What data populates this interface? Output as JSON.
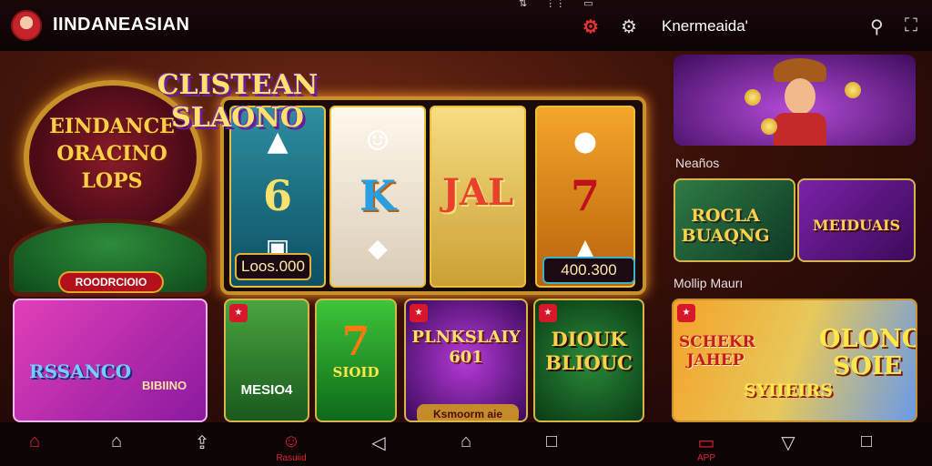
{
  "header": {
    "app_title": "IINDANEASIAN",
    "section_name": "Knermeaida'",
    "icons": [
      "app-logo",
      "brand-icon",
      "settings-icon",
      "search-icon",
      "expand-icon"
    ]
  },
  "banner_left": {
    "title": "EINDANCE ORACINO LOPS",
    "plate_text": "ROODRCIOIO"
  },
  "slot_machine": {
    "title": "CLISTEAN SLAONO",
    "reel_symbols": [
      "6",
      "K",
      "JAL",
      "7"
    ],
    "jackpot_left": "Loos.000",
    "jackpot_right": "400.300"
  },
  "right_column": {
    "label_1": "Neaños",
    "label_2": "Mollip Maurı",
    "card_r1_text": "ROCLA BUAQNG",
    "card_r2_text": "MEIDUAIS",
    "card_big": {
      "left_text": "SCHEKR JAHEP",
      "right_text": "OLONO SOIE",
      "bottom_text": "SYIIEIRS"
    }
  },
  "bottom_cards": {
    "card_1_title": "RSSANCO",
    "card_1_sub": "BIBIINO",
    "card_2_text": "MESIO4",
    "card_3_text": "SIOID",
    "card_4_text": "PLNKSLAIY 601",
    "card_4_plate": "Ksmoorm aie",
    "card_5_text": "DIOUK BLIOUC"
  },
  "bottom_nav": {
    "center_label": "Rasuiid",
    "app_label": "APP"
  }
}
